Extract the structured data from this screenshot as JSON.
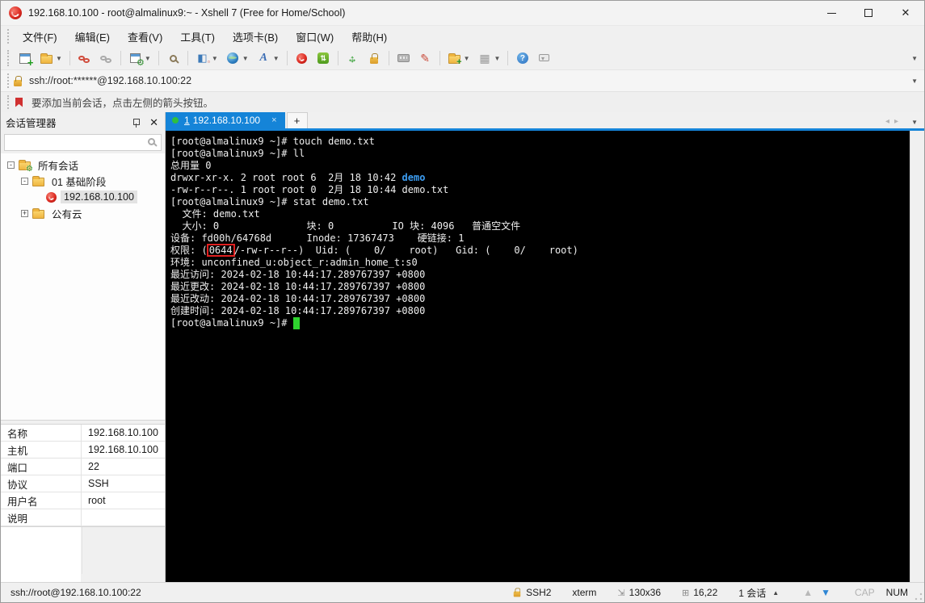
{
  "window": {
    "title": "192.168.10.100 - root@almalinux9:~ - Xshell 7 (Free for Home/School)",
    "controls": {
      "minimize": "–",
      "maximize": "□",
      "close": "✕"
    }
  },
  "menu": {
    "items": [
      "文件(F)",
      "编辑(E)",
      "查看(V)",
      "工具(T)",
      "选项卡(B)",
      "窗口(W)",
      "帮助(H)"
    ]
  },
  "toolbar": {
    "items": [
      {
        "name": "new-session",
        "caret": false,
        "sep_after": false
      },
      {
        "name": "open-folder",
        "caret": true,
        "sep_after": true
      },
      {
        "name": "disconnect",
        "caret": false,
        "sep_after": false
      },
      {
        "name": "reconnect",
        "caret": false,
        "sep_after": true
      },
      {
        "name": "session-properties",
        "caret": true,
        "sep_after": true
      },
      {
        "name": "find",
        "caret": false,
        "sep_after": true
      },
      {
        "name": "panes",
        "caret": true,
        "sep_after": false
      },
      {
        "name": "web-browser",
        "caret": true,
        "sep_after": false
      },
      {
        "name": "font",
        "caret": true,
        "sep_after": true
      },
      {
        "name": "xshell",
        "caret": false,
        "sep_after": false
      },
      {
        "name": "xftp",
        "caret": false,
        "sep_after": true
      },
      {
        "name": "fullscreen",
        "caret": false,
        "sep_after": false
      },
      {
        "name": "lock-screen",
        "caret": false,
        "sep_after": true
      },
      {
        "name": "virtual-keyboard",
        "caret": false,
        "sep_after": false
      },
      {
        "name": "highlight-pen",
        "caret": false,
        "sep_after": true
      },
      {
        "name": "new-folder",
        "caret": true,
        "sep_after": false
      },
      {
        "name": "layout",
        "caret": true,
        "sep_after": true
      },
      {
        "name": "help",
        "caret": false,
        "sep_after": false
      },
      {
        "name": "feedback",
        "caret": false,
        "sep_after": false
      }
    ]
  },
  "addressbar": {
    "url": "ssh://root:******@192.168.10.100:22"
  },
  "infobar": {
    "text": "要添加当前会话，点击左侧的箭头按钮。"
  },
  "session_manager": {
    "title": "会话管理器",
    "search_value": "",
    "tree": [
      {
        "label": "所有会话",
        "level": 0,
        "expander": "-",
        "icon": "folder-gear",
        "selected": false
      },
      {
        "label": "01 基础阶段",
        "level": 1,
        "expander": "-",
        "icon": "folder",
        "selected": false
      },
      {
        "label": "192.168.10.100",
        "level": 2,
        "expander": "",
        "icon": "session",
        "selected": true
      },
      {
        "label": "公有云",
        "level": 1,
        "expander": "+",
        "icon": "folder",
        "selected": false
      }
    ]
  },
  "properties": {
    "rows": [
      {
        "label": "名称",
        "value": "192.168.10.100"
      },
      {
        "label": "主机",
        "value": "192.168.10.100"
      },
      {
        "label": "端口",
        "value": "22"
      },
      {
        "label": "协议",
        "value": "SSH"
      },
      {
        "label": "用户名",
        "value": "root"
      },
      {
        "label": "说明",
        "value": ""
      }
    ]
  },
  "tabs": {
    "active_index": "1",
    "active_label": "192.168.10.100",
    "close": "×",
    "new_tab": "+",
    "nav_left": "◂",
    "nav_right": "▸"
  },
  "terminal": {
    "lines": [
      [
        {
          "t": "[root@almalinux9 ~]# touch demo.txt"
        }
      ],
      [
        {
          "t": "[root@almalinux9 ~]# ll"
        }
      ],
      [
        {
          "t": "总用量 0"
        }
      ],
      [
        {
          "t": "drwxr-xr-x. 2 root root 6  2月 18 10:42 "
        },
        {
          "t": "demo",
          "s": "dir"
        }
      ],
      [
        {
          "t": "-rw-r--r--. 1 root root 0  2月 18 10:44 demo.txt"
        }
      ],
      [
        {
          "t": "[root@almalinux9 ~]# stat demo.txt"
        }
      ],
      [
        {
          "t": "  文件: demo.txt"
        }
      ],
      [
        {
          "t": "  大小: 0               块: 0          IO 块: 4096   普通空文件"
        }
      ],
      [
        {
          "t": "设备: fd00h/64768d      Inode: 17367473    硬链接: 1"
        }
      ],
      [
        {
          "t": "权限: ("
        },
        {
          "t": "0644",
          "s": "box"
        },
        {
          "t": "/-rw-r--r--)  Uid: (    0/    root)   Gid: (    0/    root)"
        }
      ],
      [
        {
          "t": "环境: unconfined_u:object_r:admin_home_t:s0"
        }
      ],
      [
        {
          "t": "最近访问: 2024-02-18 10:44:17.289767397 +0800"
        }
      ],
      [
        {
          "t": "最近更改: 2024-02-18 10:44:17.289767397 +0800"
        }
      ],
      [
        {
          "t": "最近改动: 2024-02-18 10:44:17.289767397 +0800"
        }
      ],
      [
        {
          "t": "创建时间: 2024-02-18 10:44:17.289767397 +0800"
        }
      ],
      [
        {
          "t": "[root@almalinux9 ~]# "
        },
        {
          "t": " ",
          "s": "cursor"
        }
      ]
    ],
    "colors": {
      "background": "#000000",
      "foreground": "#efefef",
      "directory_blue": "#3c9df2",
      "cursor_green": "#2ed52e",
      "annotation_red": "#e02020"
    }
  },
  "statusbar": {
    "url": "ssh://root@192.168.10.100:22",
    "protocol": "SSH2",
    "terminal_type": "xterm",
    "size": "130x36",
    "cursor_position": "16,22",
    "sessions": "1 会话",
    "cap": "CAP",
    "num": "NUM"
  },
  "colors": {
    "accent_blue": "#1584d8",
    "tab_green_dot": "#2fbf3f",
    "chrome_gray": "#f0f0f0"
  }
}
